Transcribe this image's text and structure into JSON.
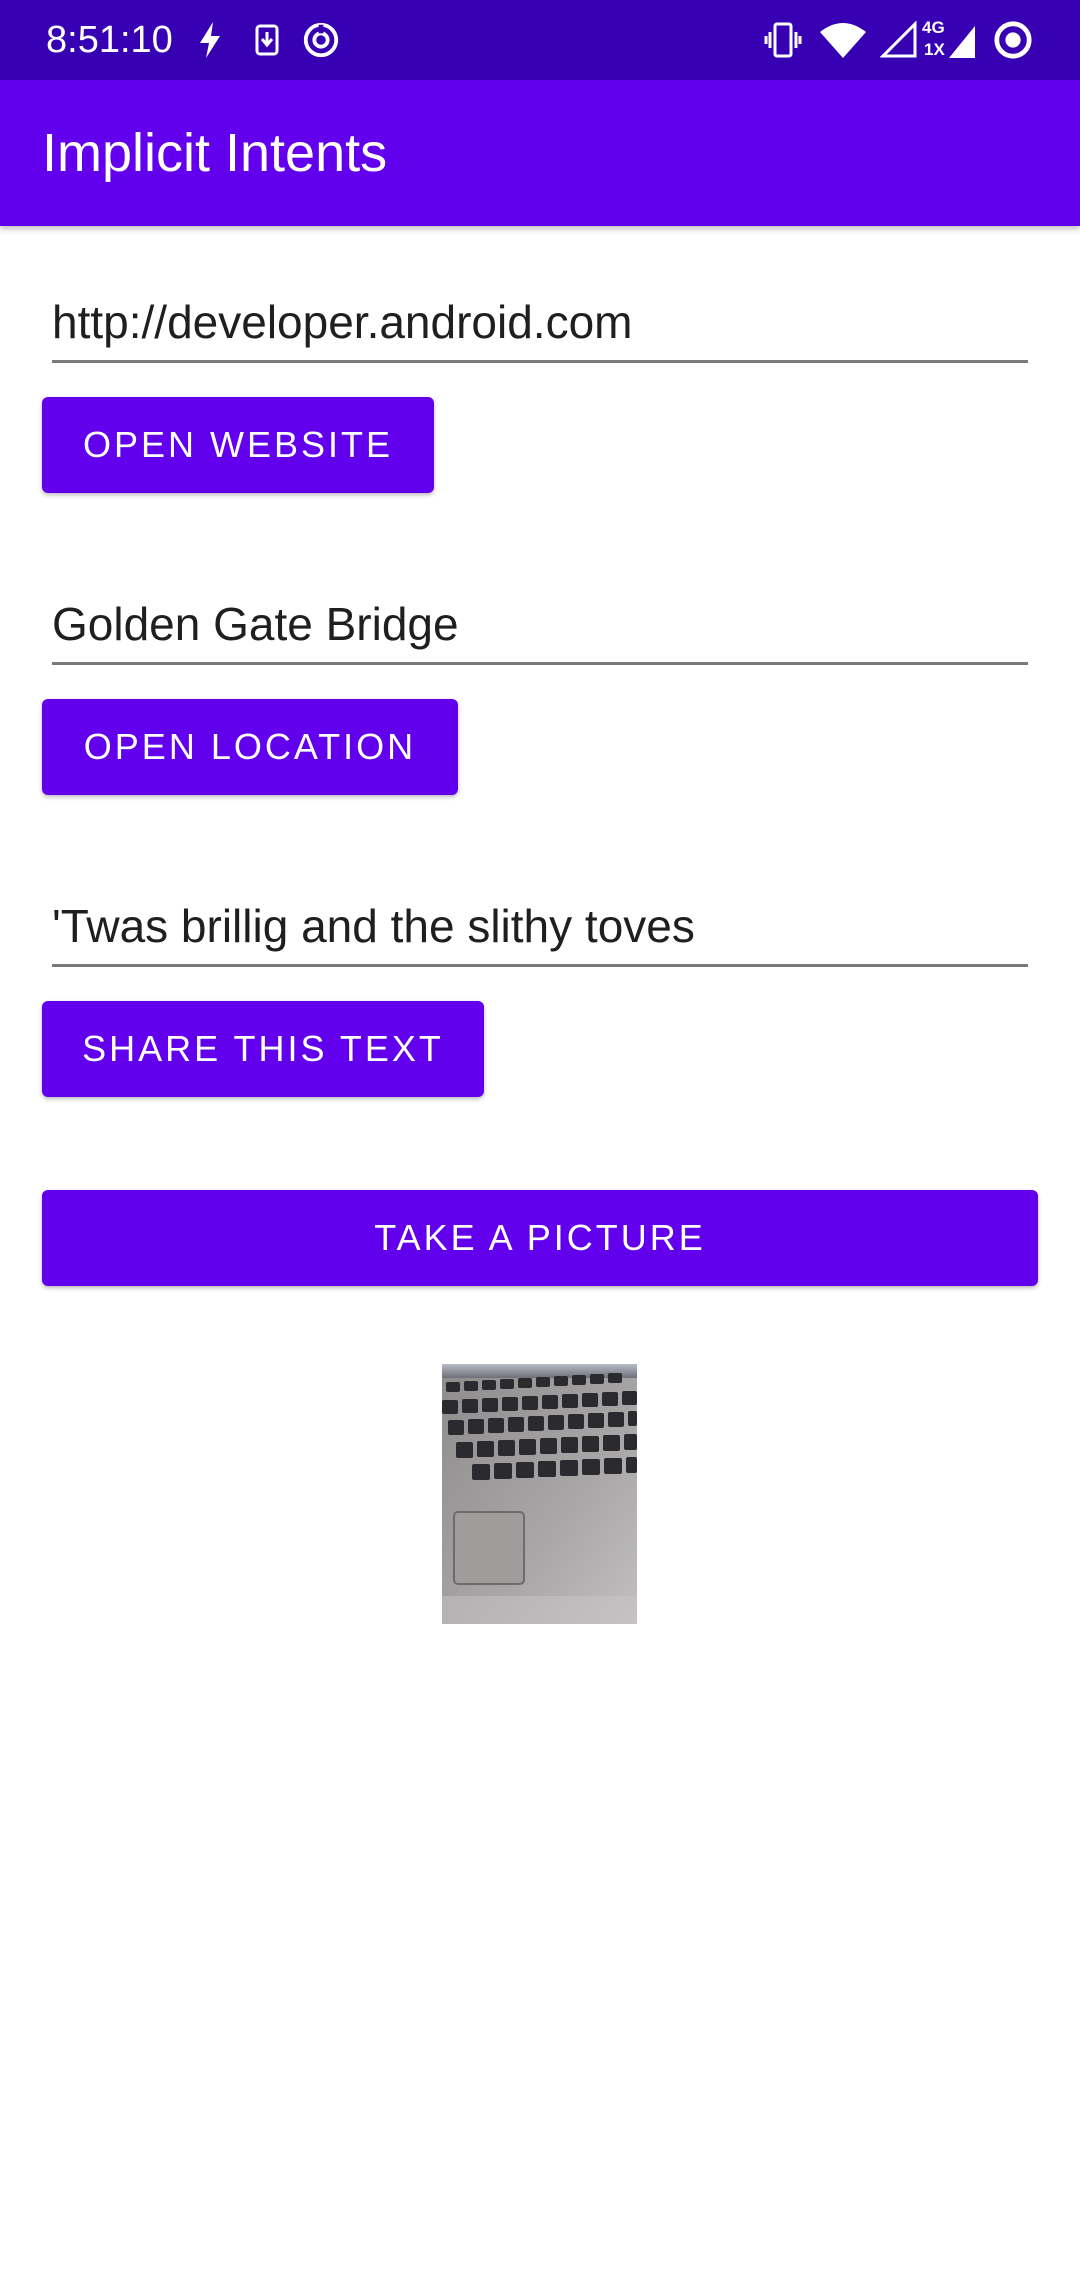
{
  "status_bar": {
    "time": "8:51:10",
    "left_icons": [
      "charging-bolt-icon",
      "download-icon",
      "data-saver-icon"
    ],
    "right_icons": [
      "vibrate-icon",
      "wifi-icon",
      "cell-signal-icon",
      "network-4g-1x-icon",
      "ring-status-icon"
    ],
    "network_top": "4G",
    "network_bottom": "1X"
  },
  "app_bar": {
    "title": "Implicit Intents",
    "color": "#6200ee"
  },
  "form": {
    "website_value": "http://developer.android.com",
    "website_button": "Open Website",
    "location_value": "Golden Gate Bridge",
    "location_button": "Open Location",
    "share_value": "'Twas brillig and the slithy toves",
    "share_button": "Share This Text",
    "picture_button": "Take a Picture"
  },
  "photo": {
    "subject": "laptop-keyboard-photo"
  },
  "colors": {
    "primary": "#6200ee",
    "primary_dark": "#3700b3",
    "text": "#1f1f1f"
  }
}
